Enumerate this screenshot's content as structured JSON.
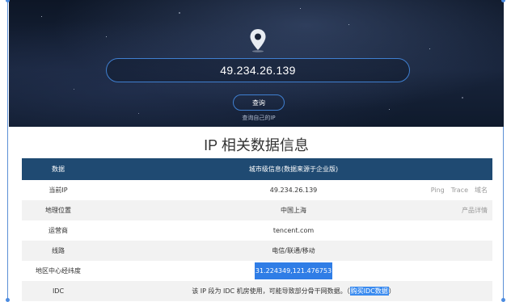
{
  "hero": {
    "ip_value": "49.234.26.139",
    "query_button": "查询",
    "self_query_link": "查询自己的IP"
  },
  "section_title": "IP 相关数据信息",
  "table": {
    "header": {
      "col1": "数据",
      "col2": "城市级信息(数据来源于企业版)"
    },
    "rows": [
      {
        "label": "当前IP",
        "value": "49.234.26.139",
        "actions": [
          "Ping",
          "Trace",
          "域名"
        ]
      },
      {
        "label": "地理位置",
        "value": "中国上海",
        "actions": [
          "产品详情"
        ]
      },
      {
        "label": "运营商",
        "value": "tencent.com",
        "actions": []
      },
      {
        "label": "线路",
        "value": "电信/联通/移动",
        "actions": []
      },
      {
        "label": "地区中心经纬度",
        "value": "31.224349,121.476753",
        "actions": []
      },
      {
        "label": "IDC",
        "value_prefix": "该 IP 段为 IDC 机房使用，可能导致部分骨干网数据。（",
        "value_link": "购买IDC数据",
        "value_suffix": "）",
        "actions": []
      }
    ]
  },
  "colors": {
    "accent": "#3f7fd0",
    "table_header": "#1f4a72",
    "highlight": "#2f7de6"
  }
}
